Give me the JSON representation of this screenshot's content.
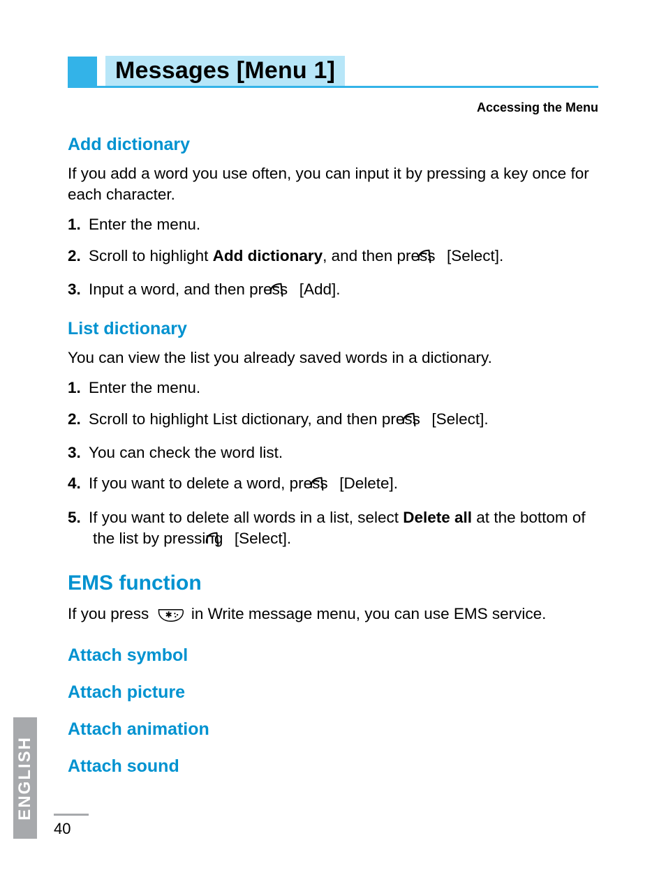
{
  "title": "Messages [Menu 1]",
  "breadcrumb": "Accessing the Menu",
  "sections": {
    "add_dict": {
      "heading": "Add dictionary",
      "intro": "If you add a word you use often, you can input it by pressing a key once for each character.",
      "steps": {
        "s1": "Enter the menu.",
        "s2_pre": "Scroll to highlight ",
        "s2_bold": "Add dictionary",
        "s2_mid": ", and then press ",
        "s2_post": " [Select].",
        "s3_pre": "Input a word, and then press ",
        "s3_post": " [Add]."
      }
    },
    "list_dict": {
      "heading": "List dictionary",
      "intro": "You can view the list you already saved words in a dictionary.",
      "steps": {
        "s1": "Enter the menu.",
        "s2_pre": "Scroll to highlight List dictionary, and then press ",
        "s2_post": " [Select].",
        "s3": "You can check the word list.",
        "s4_pre": "If you want to delete a word, press ",
        "s4_post": " [Delete].",
        "s5_pre": "If you want to delete all words in a list, select ",
        "s5_bold": "Delete all",
        "s5_mid": " at the bottom of the list by pressing ",
        "s5_post": " [Select]."
      }
    },
    "ems": {
      "heading": "EMS function",
      "intro_pre": "If you press ",
      "intro_post": " in Write message menu, you can use EMS service.",
      "items": {
        "a": "Attach symbol",
        "b": "Attach picture",
        "c": "Attach animation",
        "d": "Attach sound"
      }
    }
  },
  "side_tab": "ENGLISH",
  "page_number": "40",
  "numbers": {
    "n1": "1.",
    "n2": "2.",
    "n3": "3.",
    "n4": "4.",
    "n5": "5."
  }
}
